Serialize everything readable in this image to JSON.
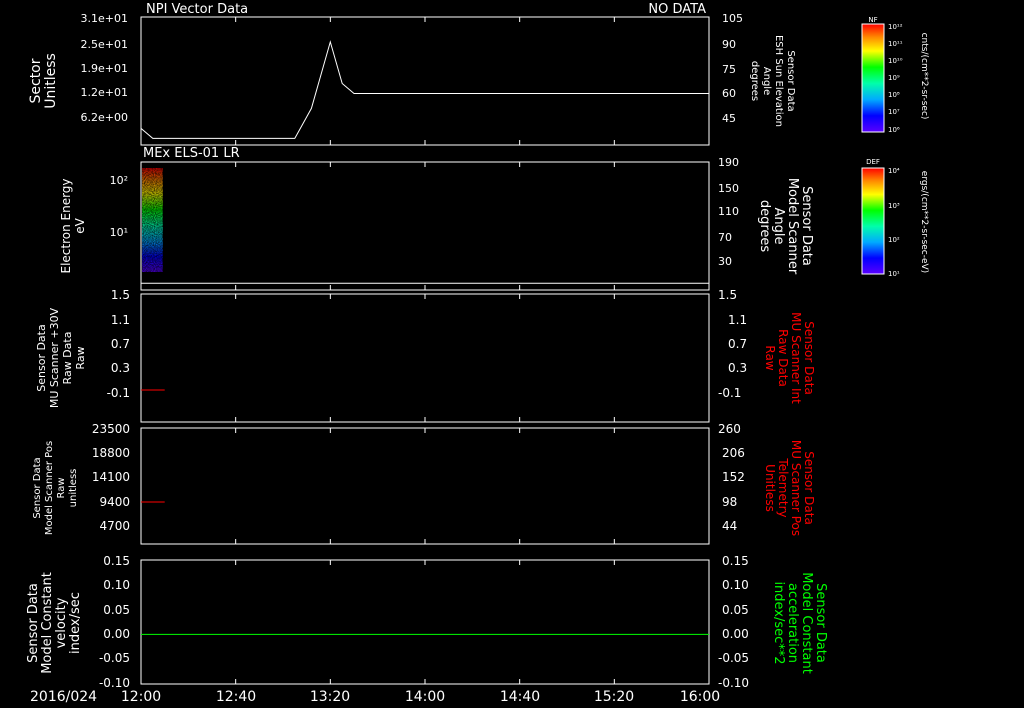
{
  "header": {
    "left_title": "NPI Vector Data",
    "right_title": "NO DATA"
  },
  "time_axis": {
    "date_label": "2016/024",
    "ticks": [
      "12:00",
      "12:40",
      "13:20",
      "14:00",
      "14:40",
      "15:20",
      "16:00"
    ]
  },
  "colors": {
    "panel_border": "#ffffff",
    "trace_white": "#ffffff",
    "trace_red": "#ff0000",
    "trace_green": "#00ff00",
    "label_red": "#ff0000",
    "label_green": "#00ff00"
  },
  "chart_data": [
    {
      "type": "line",
      "title": "NPI Vector Data",
      "ylabel": [
        "Sector",
        "Unitless"
      ],
      "yticks": [
        "3.1e+01",
        "2.5e+01",
        "1.9e+01",
        "1.2e+01",
        "6.2e+00"
      ],
      "y2label": [
        "Sensor Data",
        "ESH Sun Elevation",
        "Angle",
        "degrees"
      ],
      "y2ticks": [
        "105",
        "90",
        "75",
        "60",
        "45"
      ],
      "y2lim": [
        30,
        105
      ],
      "series": [
        {
          "values_time": [
            "12:00",
            "12:05",
            "13:05",
            "13:12",
            "13:20",
            "13:25",
            "13:30",
            "16:00"
          ],
          "values": [
            38,
            32,
            32,
            50,
            90,
            65,
            59,
            59
          ]
        }
      ]
    },
    {
      "type": "heatmap",
      "title": "MEx ELS-01 LR",
      "ylabel": [
        "Electron Energy",
        "eV"
      ],
      "yticks": [
        "10²",
        "10¹"
      ],
      "y2label": [
        "Sensor Data",
        "Model Scanner",
        "Angle",
        "degrees"
      ],
      "y2ticks": [
        "190",
        "150",
        "110",
        "70",
        "30"
      ],
      "y2lim": [
        0,
        190
      ],
      "data_time_range": [
        "12:00",
        "12:10"
      ],
      "scanner_angle_line": 10,
      "colorbar": {
        "label": "DEF",
        "units": "ergs/(cm**2-sr-sec-eV)",
        "ticks": [
          "10⁴",
          "10³",
          "10²",
          "10¹"
        ]
      }
    },
    {
      "type": "line",
      "ylabel": [
        "Sensor Data",
        "MU Scanner +30V",
        "Raw Data",
        "Raw"
      ],
      "yticks": [
        "1.5",
        "1.1",
        "0.7",
        "0.3",
        "-0.1"
      ],
      "ylim": [
        -0.5,
        1.5
      ],
      "y2label": [
        "Sensor Data",
        "MU Scanner Int",
        "Raw Data",
        "Raw"
      ],
      "y2ticks": [
        "1.5",
        "1.1",
        "0.7",
        "0.3",
        "-0.1"
      ],
      "series": [
        {
          "values_time": [
            "12:00",
            "12:10"
          ],
          "values": [
            0.0,
            0.0
          ]
        }
      ]
    },
    {
      "type": "line",
      "ylabel": [
        "Sensor Data",
        "Model Scanner Pos",
        "Raw",
        "unitless"
      ],
      "yticks": [
        "23500",
        "18800",
        "14100",
        "9400",
        "4700"
      ],
      "ylim": [
        0,
        23500
      ],
      "y2label": [
        "Sensor Data",
        "MU Scanner Pos",
        "Telemetry",
        "Unitless"
      ],
      "y2ticks": [
        "260",
        "206",
        "152",
        "98",
        "44"
      ],
      "series": [
        {
          "values_time": [
            "12:00",
            "12:10"
          ],
          "values": [
            8500,
            8500
          ]
        }
      ]
    },
    {
      "type": "line",
      "ylabel": [
        "Sensor Data",
        "Model Constant",
        "velocity",
        "index/sec"
      ],
      "yticks": [
        "0.15",
        "0.10",
        "0.05",
        "0.00",
        "-0.05",
        "-0.10"
      ],
      "ylim": [
        -0.1,
        0.15
      ],
      "y2label": [
        "Sensor Data",
        "Model Constant",
        "acceleration",
        "index/sec**2"
      ],
      "y2ticks": [
        "0.15",
        "0.10",
        "0.05",
        "0.00",
        "-0.05",
        "-0.10"
      ],
      "series": [
        {
          "values_time": [
            "12:00",
            "16:00"
          ],
          "values": [
            0.0,
            0.0
          ]
        }
      ]
    }
  ],
  "colorbars": [
    {
      "label": "NF",
      "units": "cnts/(cm**2-sr-sec)",
      "ticks": [
        "10¹²",
        "10¹¹",
        "10¹⁰",
        "10⁹",
        "10⁸",
        "10⁷",
        "10⁶"
      ]
    },
    {
      "label": "DEF",
      "units": "ergs/(cm**2-sr-sec-eV)",
      "ticks": [
        "10⁴",
        "10³",
        "10²",
        "10¹"
      ]
    }
  ]
}
